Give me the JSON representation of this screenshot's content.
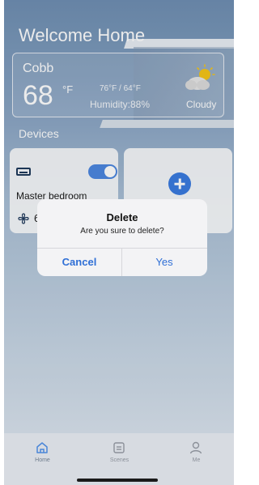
{
  "header": {
    "title": "Welcome Home"
  },
  "weather": {
    "city": "Cobb",
    "temperature": "68",
    "unit": "°F",
    "range": "76°F / 64°F",
    "humidity": "Humidity:88%",
    "condition": "Cloudy",
    "icon": "cloudy-sun-icon"
  },
  "devices": {
    "heading": "Devices",
    "items": [
      {
        "name": "Master bedroom",
        "icon": "air-conditioner-icon",
        "toggle_on": true,
        "fan_value": "6"
      }
    ],
    "add_icon": "plus-circle-icon"
  },
  "dialog": {
    "title": "Delete",
    "message": "Are you sure to delete?",
    "cancel_label": "Cancel",
    "confirm_label": "Yes"
  },
  "tabbar": {
    "items": [
      {
        "label": "Home",
        "icon": "home-icon"
      },
      {
        "label": "Scenes",
        "icon": "scenes-icon"
      },
      {
        "label": "Me",
        "icon": "person-icon"
      }
    ]
  },
  "colors": {
    "accent": "#3a7be0",
    "dialog_button": "#2f6fd6"
  }
}
